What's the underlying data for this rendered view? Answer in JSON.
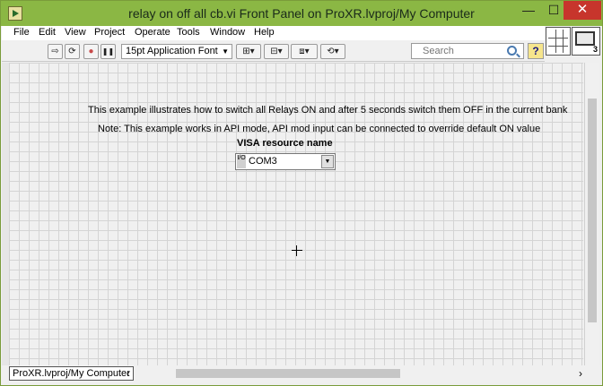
{
  "window": {
    "title": "relay on off all cb.vi Front Panel on ProXR.lvproj/My Computer",
    "min_label": "—",
    "max_label": "☐",
    "close_label": "✕"
  },
  "menu": [
    "File",
    "Edit",
    "View",
    "Project",
    "Operate",
    "Tools",
    "Window",
    "Help"
  ],
  "toolbar": {
    "run_glyph": "⇨",
    "run_continuous_glyph": "⟳",
    "abort_glyph": "●",
    "pause_glyph": "❚❚",
    "font_label": "15pt Application Font",
    "dropdown_glyph": "▼",
    "align_glyph": "⊞▾",
    "distribute_glyph": "⊟▾",
    "resize_glyph": "⧈▾",
    "reorder_glyph": "⟲▾",
    "search_placeholder": "Search",
    "help_glyph": "?"
  },
  "panel": {
    "description_line1": "This example illustrates how to switch all Relays ON and after 5 seconds switch them OFF in the current bank",
    "description_line2": "Note: This example works in API mode, API mod input can be connected to override default ON value",
    "visa_label": "VISA resource name",
    "visa_icon": "I/O",
    "visa_value": "COM3",
    "visa_dropdown_glyph": "▼"
  },
  "vi_icon_number": "3",
  "status": {
    "project_label": "ProXR.lvproj/My Computer",
    "scroll_left_glyph": "‹",
    "scroll_right_glyph": "›"
  },
  "colors": {
    "titlebar": "#8bb744",
    "close_button": "#c7352c",
    "grid_line": "#d4d4d4"
  }
}
